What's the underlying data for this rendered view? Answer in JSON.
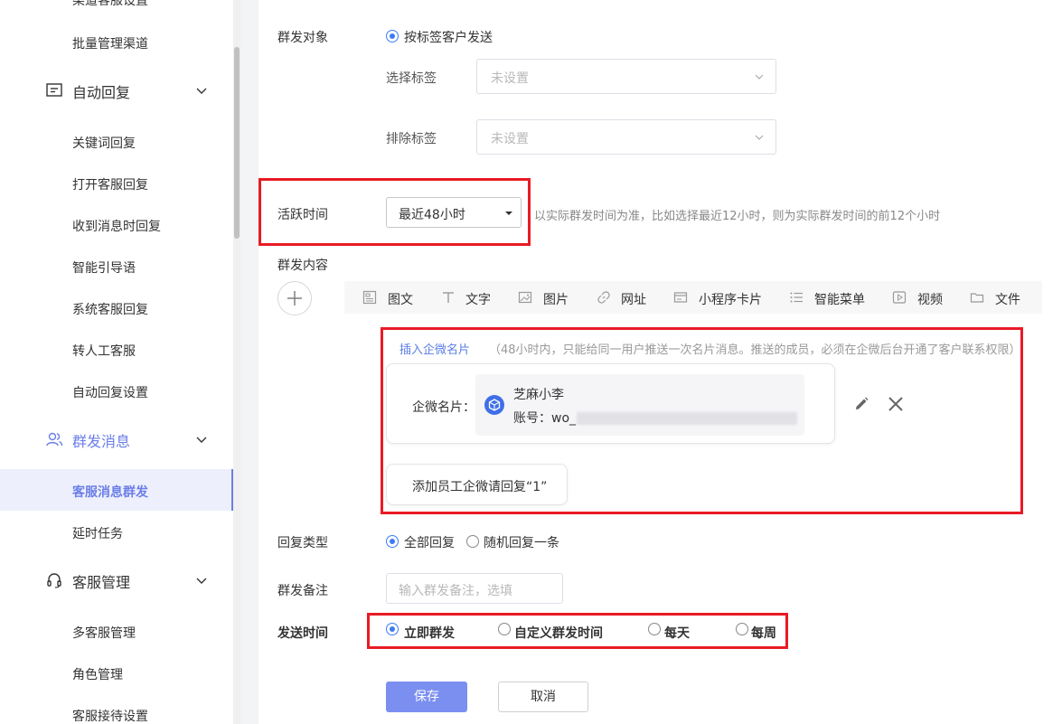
{
  "sidebar": {
    "top_cut_item": "渠道客服设置",
    "batch_manage": "批量管理渠道",
    "auto_reply": {
      "label": "自动回复",
      "items": [
        "关键词回复",
        "打开客服回复",
        "收到消息时回复",
        "智能引导语",
        "系统客服回复",
        "转人工客服",
        "自动回复设置"
      ]
    },
    "group_msg": {
      "label": "群发消息",
      "items": [
        "客服消息群发",
        "延时任务"
      ]
    },
    "service_mgmt": {
      "label": "客服管理",
      "items": [
        "多客服管理",
        "角色管理",
        "客服接待设置"
      ]
    }
  },
  "form": {
    "target": {
      "label": "群发对象",
      "option": "按标签客户发送"
    },
    "select_tag": {
      "label": "选择标签",
      "placeholder": "未设置"
    },
    "exclude_tag": {
      "label": "排除标签",
      "placeholder": "未设置"
    },
    "active_time": {
      "label": "活跃时间",
      "value": "最近48小时",
      "hint": "以实际群发时间为准，比如选择最近12小时，则为实际群发时间的前12个小时"
    },
    "content": {
      "label": "群发内容",
      "tools": [
        "图文",
        "文字",
        "图片",
        "网址",
        "小程序卡片",
        "智能菜单",
        "视频",
        "文件"
      ],
      "insert_card_link": "插入企微名片",
      "insert_card_note": "（48小时内，只能给同一用户推送一次名片消息。推送的成员，必须在企微后台开通了客户联系权限）",
      "card_label": "企微名片：",
      "card_name": "芝麻小李",
      "card_account_prefix": "账号：wo_",
      "reply_hint": "添加员工企微请回复“1”"
    },
    "reply_type": {
      "label": "回复类型",
      "options": [
        "全部回复",
        "随机回复一条"
      ]
    },
    "remark": {
      "label": "群发备注",
      "placeholder": "输入群发备注，选填"
    },
    "send_time": {
      "label": "发送时间",
      "options": [
        "立即群发",
        "自定义群发时间",
        "每天",
        "每周"
      ]
    },
    "save_label": "保存",
    "cancel_label": "取消"
  },
  "colors": {
    "accent": "#3d7bf5",
    "highlight": "#e81b25",
    "save_btn": "#7b8ff0",
    "active_bg": "#edf0fc"
  }
}
